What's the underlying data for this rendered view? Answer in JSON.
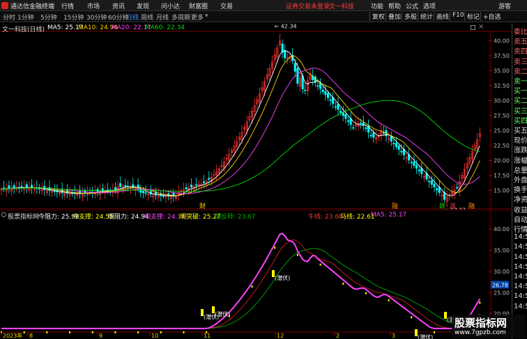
{
  "titlebar": {
    "app_name": "通达信金融终端",
    "menus": [
      "行情",
      "市场",
      "资讯",
      "发现",
      "问小达",
      "财富圈",
      "交易"
    ],
    "notice": "证券交易未登录",
    "stock_name": "文一科技",
    "right_menus": [
      "功能",
      "帮助",
      "公式",
      "选项",
      "游客"
    ]
  },
  "toolbar": {
    "periods": [
      "分时",
      "1分钟",
      "5分钟",
      "15分钟",
      "30分钟",
      "60分钟",
      "日线",
      "周线",
      "月线",
      "多周期",
      "更多"
    ],
    "active_period": "日线",
    "right_buttons": [
      "复权",
      "叠加",
      "多股",
      "统计",
      "画线",
      "F10",
      "标记",
      "+自选"
    ]
  },
  "main_chart": {
    "stock_label": "文一科技(日线)",
    "ma": [
      {
        "label": "MA5: 25.17",
        "color": "#ffffff"
      },
      {
        "label": "MA10: 24.96",
        "color": "#ffd200"
      },
      {
        "label": "MA20: 22.17",
        "color": "#ff44ff"
      },
      {
        "label": "MA60: 22.34",
        "color": "#00dd00"
      }
    ],
    "high_label": "42.34",
    "low_label": "12.11",
    "markers": [
      {
        "text": "财",
        "color": "#ffcc00"
      },
      {
        "text": "融",
        "color": "#ff8800"
      },
      {
        "text": "跌",
        "color": "#00dd00"
      },
      {
        "text": "涨",
        "color": "#ff3333"
      },
      {
        "text": "融",
        "color": "#ff8800"
      }
    ],
    "y_ticks": [
      "40.00",
      "37.50",
      "35.00",
      "32.50",
      "30.00",
      "27.50",
      "25.00",
      "22.50",
      "20.00",
      "17.50",
      "15.00"
    ]
  },
  "indicator": {
    "title": "股票指标网",
    "items": [
      {
        "label": "今阻力: 25.98",
        "color": "#ffffff"
      },
      {
        "label": "今支撑: 24.55",
        "color": "#ffff00"
      },
      {
        "label": "明阻力: 24.94",
        "color": "#ffffff"
      },
      {
        "label": "明支撑: 24.14",
        "color": "#ff44ff"
      },
      {
        "label": "明突破: 25.27",
        "color": "#ffff00"
      },
      {
        "label": "明反转: 23.67",
        "color": "#00aa00"
      }
    ],
    "items_right": [
      {
        "label": "牛线: 23.66",
        "color": "#ff3333"
      },
      {
        "label": "马线: 22.61",
        "color": "#ffff00"
      },
      {
        "label": "MA5: 25.17",
        "color": "#ff44ff"
      }
    ],
    "y_ticks": [
      "40.00",
      "35.00",
      "30.00",
      "25.00",
      "20.00"
    ],
    "current_value": "26.78",
    "annotations": [
      "(潜伏)",
      "(潜伏)",
      "(潜伏)",
      "(潜伏)",
      "(潜伏)"
    ],
    "x_labels": [
      "2023年",
      "8",
      "9",
      "10",
      "11",
      "12",
      "2",
      "3"
    ]
  },
  "sidebar": {
    "items": [
      "委比",
      "卖五",
      "卖四",
      "卖三",
      "卖二",
      "卖一",
      "买一",
      "买二",
      "买三",
      "买四",
      "买五",
      "现价",
      "涨跌",
      "涨幅",
      "总量",
      "外盘",
      "换手",
      "净资",
      "收益",
      "自动",
      "行情",
      "14:5",
      "14:5",
      "14:5",
      "14:5",
      "14:5",
      "14:5",
      "14:5",
      "14:5"
    ]
  },
  "watermark": {
    "title": "股票指标网",
    "url": "www.7gpzb.com"
  },
  "colors": {
    "up": "#ff3333",
    "down": "#00ffff",
    "ma5": "#ffffff",
    "ma10": "#ffd200",
    "ma20": "#ff44ff",
    "ma60": "#00dd00"
  }
}
